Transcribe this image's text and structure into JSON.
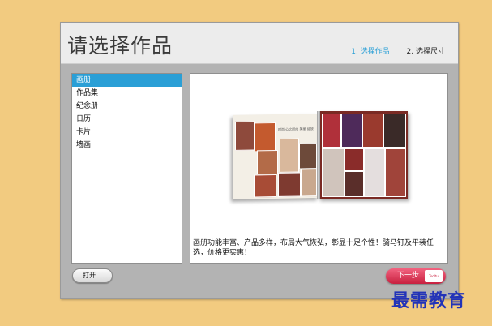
{
  "header": {
    "title": "请选择作品",
    "steps": [
      {
        "label": "1. 选择作品",
        "active": true
      },
      {
        "label": "2. 选择尺寸",
        "active": false
      }
    ]
  },
  "categories": [
    {
      "label": "画册",
      "selected": true
    },
    {
      "label": "作品集",
      "selected": false
    },
    {
      "label": "纪念册",
      "selected": false
    },
    {
      "label": "日历",
      "selected": false
    },
    {
      "label": "卡片",
      "selected": false
    },
    {
      "label": "墙画",
      "selected": false
    }
  ],
  "preview": {
    "description": "画册功能丰富、产品多样，布局大气恢弘，彰显十足个性！骑马钉及平装任选，价格更实惠！",
    "caption_lines": "时尚 心之所向 美丽 绽放"
  },
  "buttons": {
    "open_label": "打开...",
    "next_label": "下一步",
    "next_tag": "Tooltu"
  },
  "watermark": "最需教育",
  "colors": {
    "background": "#f2cb80",
    "accent_blue": "#2a9fd6",
    "next_button": "#d8294a",
    "watermark": "#2233b8"
  }
}
